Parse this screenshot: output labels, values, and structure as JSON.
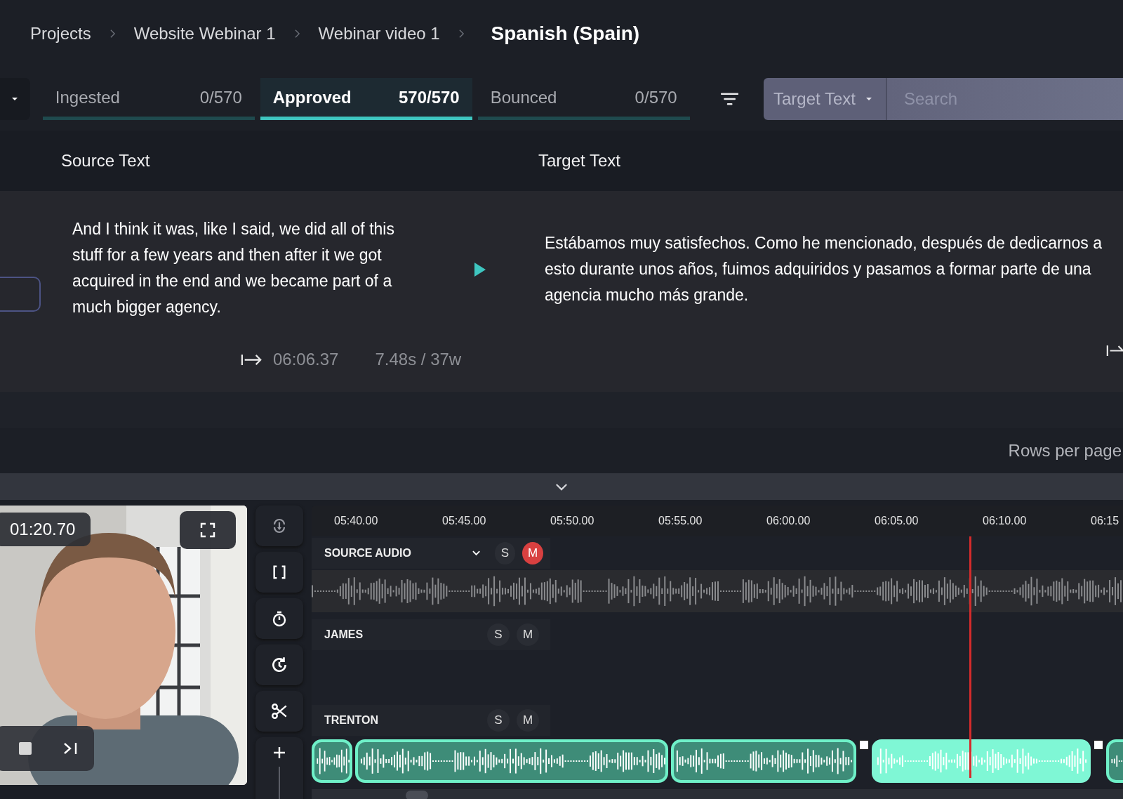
{
  "breadcrumb": [
    {
      "label": "Projects",
      "current": false
    },
    {
      "label": "Website Webinar 1",
      "current": false
    },
    {
      "label": "Webinar video 1",
      "current": false
    },
    {
      "label": "Spanish (Spain)",
      "current": true
    }
  ],
  "tabs": [
    {
      "label": "Ingested",
      "count": "0/570",
      "selected": false
    },
    {
      "label": "Approved",
      "count": "570/570",
      "selected": true
    },
    {
      "label": "Bounced",
      "count": "0/570",
      "selected": false
    }
  ],
  "search": {
    "filter_label": "Target Text",
    "placeholder": "Search"
  },
  "table": {
    "columns": [
      "Source Text",
      "Target Text"
    ],
    "rows": [
      {
        "source": "And I think it was, like I said, we did all of this stuff for a few years and then after it we got acquired in the end and we became part of a much bigger agency.",
        "target": "Estábamos muy satisfechos. Como he mencionado, después de dedicarnos a esto durante unos años, fuimos adquiridos y pasamos a formar parte de una agencia mucho más grande.",
        "timestamp": "06:06.37",
        "stats": "7.48s / 37w"
      }
    ]
  },
  "pagination": {
    "label": "Rows per page"
  },
  "player": {
    "time": "01:20.70"
  },
  "timeline": {
    "ticks": [
      "05:40.00",
      "05:45.00",
      "05:50.00",
      "05:55.00",
      "06:00.00",
      "06:05.00",
      "06:10.00",
      "06:15"
    ],
    "tracks": [
      {
        "name": "SOURCE AUDIO",
        "kind": "source",
        "solo": false,
        "mute": true,
        "solo_label": "S",
        "mute_label": "M"
      },
      {
        "name": "JAMES",
        "kind": "empty",
        "solo": false,
        "mute": false,
        "solo_label": "S",
        "mute_label": "M"
      },
      {
        "name": "TRENTON",
        "kind": "clips",
        "solo": false,
        "mute": false,
        "solo_label": "S",
        "mute_label": "M",
        "clips": [
          {
            "selected": false
          },
          {
            "selected": false
          },
          {
            "selected": false
          },
          {
            "selected": true
          },
          {
            "selected": false
          }
        ]
      }
    ]
  }
}
